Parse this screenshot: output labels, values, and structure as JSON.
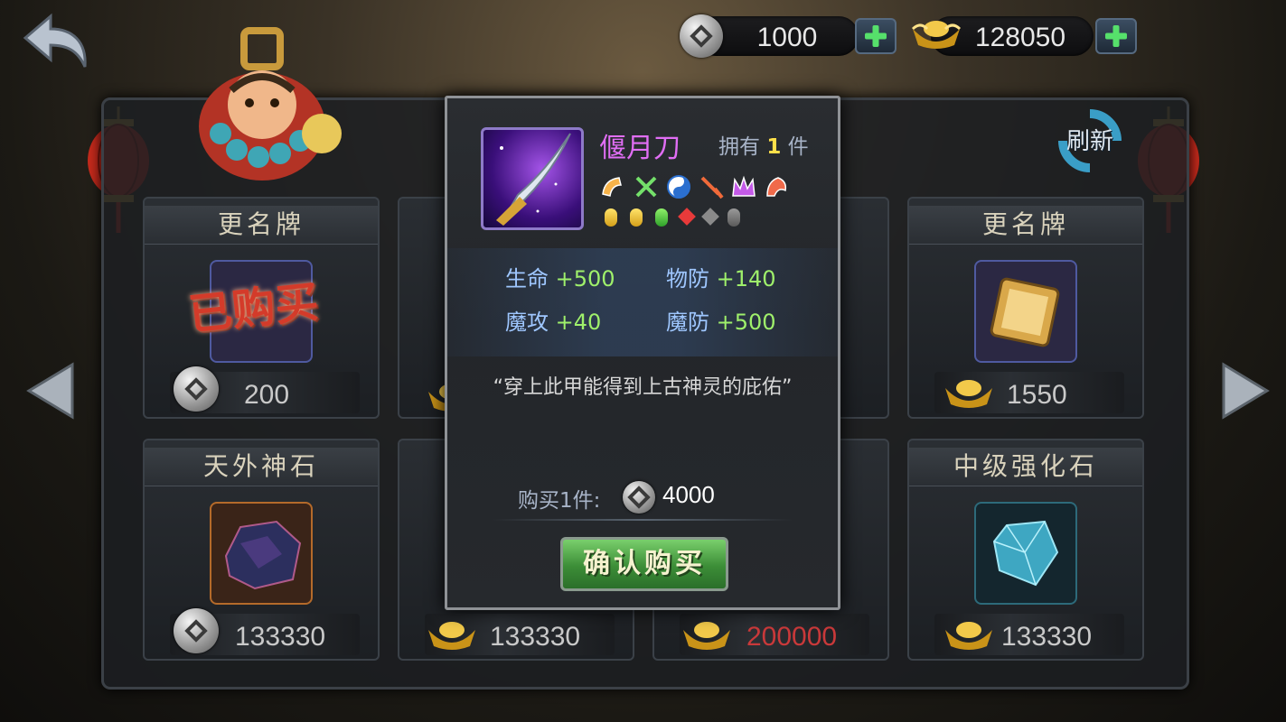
{
  "header": {
    "silver_amount": "1000",
    "gold_amount": "128050"
  },
  "shop": {
    "refresh_label": "刷新",
    "cards": [
      {
        "title": "更名牌",
        "price": "200",
        "currency": "silver",
        "bought_stamp": "已购买"
      },
      {
        "title": "更名牌",
        "price": "1550",
        "currency": "gold"
      },
      {
        "title": "天外神石",
        "price": "133330",
        "currency": "silver"
      },
      {
        "title": "",
        "price": "133330",
        "currency": "gold"
      },
      {
        "title": "",
        "price": "200000",
        "currency": "gold",
        "price_color": "#c9393a"
      },
      {
        "title": "中级强化石",
        "price": "133330",
        "currency": "gold"
      }
    ]
  },
  "popup": {
    "item_name": "偃月刀",
    "owned_prefix": "拥有",
    "owned_count": "1",
    "owned_suffix": "件",
    "stats": [
      {
        "name": "生命",
        "value": "+500"
      },
      {
        "name": "物防",
        "value": "+140"
      },
      {
        "name": "魔攻",
        "value": "+40"
      },
      {
        "name": "魔防",
        "value": "+500"
      }
    ],
    "description": "“穿上此甲能得到上古神灵的庇佑”",
    "buy_label": "购买1件:",
    "buy_price": "4000",
    "confirm_label": "确认购买"
  },
  "colors": {
    "item_name": "#e16ef5",
    "stat_name": "#9fc7ff",
    "stat_value": "#9ff06b",
    "owned_count": "#ffe04a",
    "confirm_button": "#3c8d37"
  }
}
